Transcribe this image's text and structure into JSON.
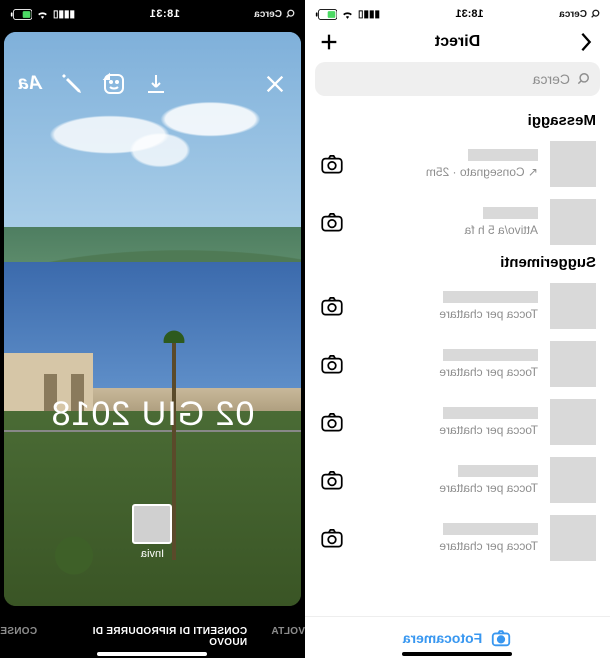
{
  "status": {
    "time": "18:31",
    "search_label": "Cerca"
  },
  "story": {
    "date_stamp": "02 GIU 2018",
    "send_label": "Invia",
    "tabs": {
      "once": "VOLTA",
      "replay": "CONSENTI DI RIPRODURRE DI NUOVO",
      "keep": "CONSE"
    }
  },
  "direct": {
    "title": "Direct",
    "search_placeholder": "Cerca",
    "sections": {
      "messages": "Messaggi",
      "suggestions": "Suggerimenti"
    },
    "messages": [
      {
        "subtitle": "↖ Consegnato · 25m",
        "name_width": 70
      },
      {
        "subtitle": "Attivo/a 5 h fa",
        "name_width": 55
      }
    ],
    "suggestions": [
      {
        "subtitle": "Tocca per chattare",
        "name_width": 95
      },
      {
        "subtitle": "Tocca per chattare",
        "name_width": 95
      },
      {
        "subtitle": "Tocca per chattare",
        "name_width": 95
      },
      {
        "subtitle": "Tocca per chattare",
        "name_width": 80
      },
      {
        "subtitle": "Tocca per chattare",
        "name_width": 95
      }
    ],
    "footer_label": "Fotocamera"
  },
  "colors": {
    "accent": "#3897f0",
    "placeholder": "#d9d9d9",
    "muted": "#8e8e8e"
  }
}
